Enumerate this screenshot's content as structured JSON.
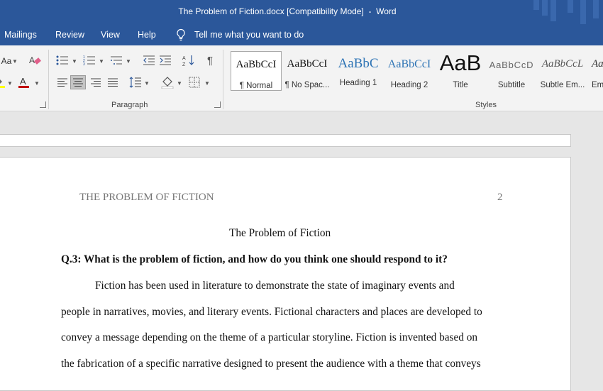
{
  "window": {
    "title": "The Problem of Fiction.docx [Compatibility Mode]  -  Word"
  },
  "menu": {
    "tabs": [
      "Mailings",
      "Review",
      "View",
      "Help"
    ],
    "tell_me": "Tell me what you want to do"
  },
  "ribbon": {
    "font_group": {
      "change_case": "Aa",
      "font_color_glyph": "A"
    },
    "paragraph_group": {
      "label": "Paragraph",
      "pilcrow": "¶"
    },
    "styles_group": {
      "label": "Styles",
      "items": [
        {
          "preview": "AaBbCcI",
          "name": "¶ Normal"
        },
        {
          "preview": "AaBbCcI",
          "name": "¶ No Spac..."
        },
        {
          "preview": "AaBbC",
          "name": "Heading 1"
        },
        {
          "preview": "AaBbCcI",
          "name": "Heading 2"
        },
        {
          "preview": "AaB",
          "name": "Title"
        },
        {
          "preview": "AaBbCcD",
          "name": "Subtitle"
        },
        {
          "preview": "AaBbCcL",
          "name": "Subtle Em..."
        },
        {
          "preview": "Aa",
          "name": "Em"
        }
      ]
    }
  },
  "document": {
    "header_text": "THE PROBLEM OF FICTION",
    "page_number": "2",
    "title": "The Problem of Fiction",
    "question": "Q.3: What is the problem of fiction, and how do you think one should respond to it?",
    "body_lines": [
      "Fiction has been used in literature to demonstrate the state of imaginary events and",
      "people in narratives, movies, and literary events. Fictional characters and places are developed to",
      "convey a message depending on the theme of a particular storyline. Fiction is invented based on",
      "the fabrication of a specific narrative designed to present the audience with a theme that conveys"
    ]
  },
  "colors": {
    "brand_blue": "#2b579a",
    "ribbon_bg": "#f3f3f3",
    "canvas_bg": "#e6e6e6",
    "heading_blue": "#2e74b5",
    "font_color_red": "#c00000",
    "eraser_pink": "#e05f8a"
  }
}
